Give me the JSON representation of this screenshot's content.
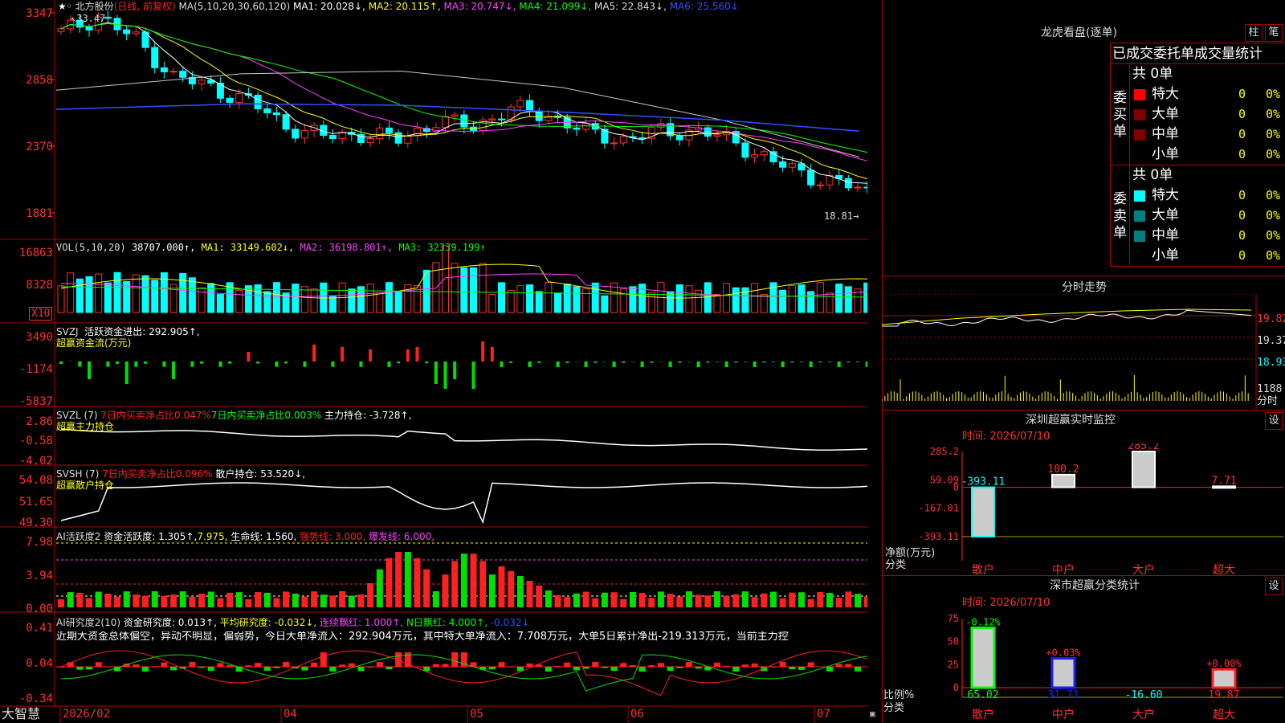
{
  "app": {
    "brand": "大智慧"
  },
  "header": {
    "stock_name": "北方股份",
    "mode": "(日线, 前复权)",
    "ma_title": "MA(5,10,20,30,60,120)",
    "ma1": "MA1: 20.028↓,",
    "ma2": "MA2: 20.115↑,",
    "ma3": "MA3: 20.747↓,",
    "ma4": "MA4: 21.099↓,",
    "ma5": "MA5: 22.843↓,",
    "ma6": "MA6: 25.560↓"
  },
  "price_axis": [
    "3347",
    "2858",
    "2370",
    "1881"
  ],
  "price_notes": {
    "high": "33.47",
    "low": "18.81"
  },
  "vol": {
    "title": "VOL(5,10,20)",
    "value": "38707.000↑,",
    "ma1": "MA1: 33149.602↓,",
    "ma2": "MA2: 36198.801↑,",
    "ma3": "MA3: 32339.199↑",
    "axis": [
      "16863",
      "8328"
    ],
    "unit": "X10"
  },
  "svzj": {
    "title": "SVZJ",
    "desc": "活跃资金进出: 292.905↑,",
    "sub": "超赢资金流(万元)",
    "axis": [
      "3490",
      "-1174",
      "-5837"
    ]
  },
  "svzl": {
    "title": "SVZL (7)",
    "a": "7日内买卖净占比0.047%",
    "b": "7日内买卖净占比0.003%",
    "c": "主力持仓: -3.728↑,",
    "sub": "超赢主力持仓",
    "axis": [
      "2.86",
      "-0.58",
      "-4.02"
    ]
  },
  "svsh": {
    "title": "SVSH (7)",
    "a": "7日内买卖净占比0.096%",
    "c": "散户持仓: 53.520↓,",
    "sub": "超赢散户持仓",
    "axis": [
      "54.08",
      "51.65",
      "49.30"
    ]
  },
  "ai1": {
    "title": "AI活跃度2",
    "a": "资金活跃度: 1.305↑,",
    "b": "7.975,",
    "c": "生命线: 1.560,",
    "d": "强势线: 3.000,",
    "e": "爆发线: 6.000,",
    "axis": [
      "7.98",
      "3.94",
      "0.00"
    ]
  },
  "ai2": {
    "title": "AI研究度2(10)",
    "a": "资金研究度: 0.013↑,",
    "b": "平均研究度: -0.032↓,",
    "c": "连续飘红: 1.000↑,",
    "d": "N日飘红: 4.000↑,",
    "e": "-0.032↓",
    "comment": "近期大资金总体偏空，异动不明显，偏弱势，今日大单净流入：292.904万元，其中特大单净流入：7.708万元，大单5日累计净出-219.313万元，当前主力控",
    "axis": [
      "0.41",
      "0.04",
      "-0.34"
    ]
  },
  "dates": [
    "2026/02",
    "04",
    "05",
    "06",
    "07"
  ],
  "right": {
    "longhu_title": "龙虎看盘(逐单)",
    "btn_zhu": "柱",
    "btn_bi": "笔",
    "table_title": "已成交委托单成交量统计",
    "buy_label": "委买单",
    "sell_label": "委卖单",
    "buy_total": "共 0单",
    "sell_total": "共 0单",
    "rows": [
      {
        "name": "特大",
        "val": "0",
        "pct": "0%"
      },
      {
        "name": "大单",
        "val": "0",
        "pct": "0%"
      },
      {
        "name": "中单",
        "val": "0",
        "pct": "0%"
      },
      {
        "name": "小单",
        "val": "0",
        "pct": "0%"
      }
    ],
    "buy_colors": [
      "#ff0000",
      "#800000",
      "#800000",
      "#000000"
    ],
    "sell_colors": [
      "#00ffff",
      "#008080",
      "#008080",
      "#000000"
    ],
    "fenshi_title": "分时走势",
    "fenshi_axis": [
      "19.82",
      "19.37",
      "18.93"
    ],
    "fenshi_vol_axis": "1188",
    "fenshi_unit": "分时",
    "monitor_title": "深圳超赢实时监控",
    "btn_she": "设",
    "monitor_time": "时间: 2026/07/10",
    "monitor_axis": [
      "285.2",
      "59.09",
      "0",
      "-167.01",
      "-393.11"
    ],
    "monitor_ylabel": "净额(万元)",
    "monitor_xlabel": "分类",
    "class_title": "深市超赢分类统计",
    "class_time": "时间: 2026/07/10",
    "class_axis": [
      "75",
      "50",
      "25",
      "0"
    ],
    "class_ylabel": "比例%",
    "class_xlabel": "分类"
  },
  "chart_data": [
    {
      "type": "bar",
      "title": "深圳超赢实时监控",
      "categories": [
        "散户",
        "中户",
        "大户",
        "超大"
      ],
      "values": [
        -393.11,
        100.2,
        285.2,
        7.71
      ],
      "ylim": [
        -393.11,
        285.2
      ],
      "labels": [
        "-393.11",
        "100.2",
        "285.2",
        "7.71"
      ]
    },
    {
      "type": "bar",
      "title": "深市超赢分类统计",
      "categories": [
        "散户",
        "中户",
        "大户",
        "超大"
      ],
      "values": [
        65.02,
        31.71,
        -16.6,
        19.87
      ],
      "change": [
        "-0.12%",
        "+0.03%",
        "",
        "+0.00%"
      ],
      "bottom_labels": [
        "65.02",
        "31.71",
        "-16.60",
        "19.87"
      ],
      "ylim": [
        0,
        75
      ]
    }
  ]
}
